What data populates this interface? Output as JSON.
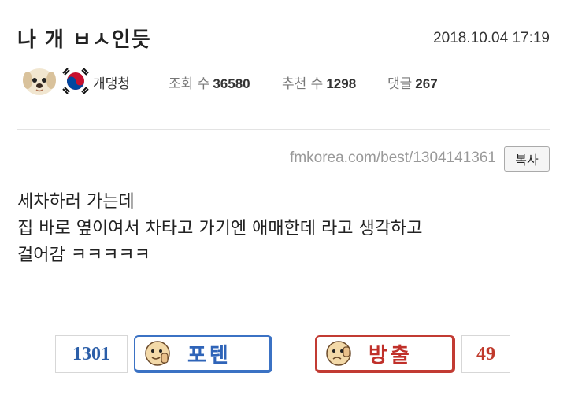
{
  "post": {
    "title": "나 개 ㅂㅅ인듯",
    "date": "2018.10.04 17:19"
  },
  "meta": {
    "author": "개댕청",
    "views_label": "조회 수",
    "views": "36580",
    "recommend_label": "추천 수",
    "recommend": "1298",
    "comments_label": "댓글",
    "comments": "267"
  },
  "link": {
    "url": "fmkorea.com/best/1304141361",
    "copy_label": "복사"
  },
  "body": {
    "lines": [
      "세차하러 가는데",
      "집 바로 옆이여서 차타고 가기엔 애매한데 라고 생각하고",
      "걸어감 ㅋㅋㅋㅋㅋ"
    ]
  },
  "votes": {
    "up_count": "1301",
    "up_label": "포텐",
    "down_label": "방출",
    "down_count": "49"
  },
  "icons": {
    "avatar": "puppy-avatar-icon",
    "level": "korean-flag-icon",
    "up_face": "thumbs-up-face-icon",
    "down_face": "thumbs-down-face-icon"
  },
  "colors": {
    "up": "#2f64b8",
    "down": "#c0302a"
  }
}
